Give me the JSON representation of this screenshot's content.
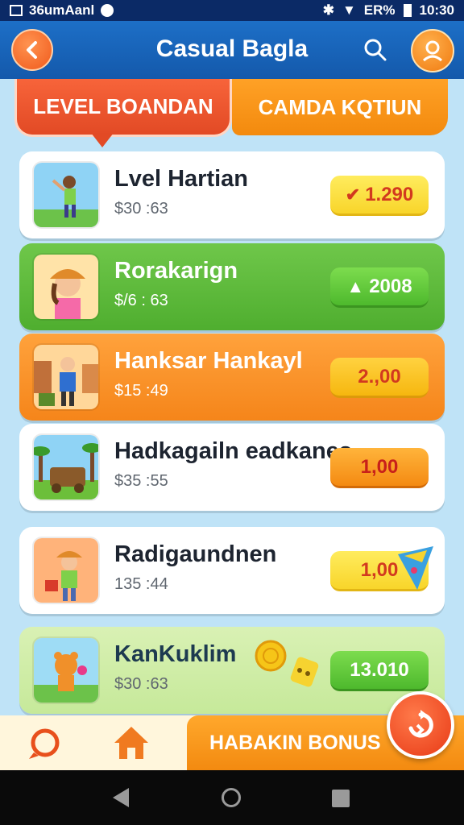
{
  "status_bar": {
    "carrier": "36umAanl",
    "battery_text": "ER%",
    "time": "10:30"
  },
  "app_bar": {
    "title": "Casual Bagla",
    "back_icon": "chevron-left-icon",
    "search_icon": "search-icon",
    "profile_icon": "user-icon"
  },
  "tabs": [
    {
      "label": "LEVEL BOANDAN"
    },
    {
      "label": "CAMDA KQTIUN"
    }
  ],
  "items": [
    {
      "title": "Lvel Hartian",
      "subtitle": "$30 :63",
      "price": "1.290",
      "price_icon": "✔"
    },
    {
      "title": "Rorakarign",
      "subtitle": "$/6 : 63",
      "price": "2008",
      "price_icon": "▲"
    },
    {
      "title": "Hanksar Hankayl",
      "subtitle": "$15 :49",
      "price": "2.,00",
      "price_icon": ""
    },
    {
      "title": "Hadkagailn eadkanes",
      "subtitle": "$35 :55",
      "price": "1,00",
      "price_icon": ""
    },
    {
      "title": "Radigaundnen",
      "subtitle": "135 :44",
      "price": "1,00",
      "price_icon": ""
    },
    {
      "title": "KanKuklim",
      "subtitle": "$30 :63",
      "price": "13.010",
      "price_icon": ""
    }
  ],
  "bottom_nav": {
    "chat_icon": "chat-icon",
    "home_icon": "home-icon",
    "bonus_label": "HABAKIN BONUS",
    "fab_icon": "refresh-icon"
  },
  "colors": {
    "app_bar": "#1a66bd",
    "accent_orange": "#f38a10",
    "accent_red": "#e24a25",
    "accent_green": "#4fae2f",
    "background": "#bfe3f7"
  }
}
